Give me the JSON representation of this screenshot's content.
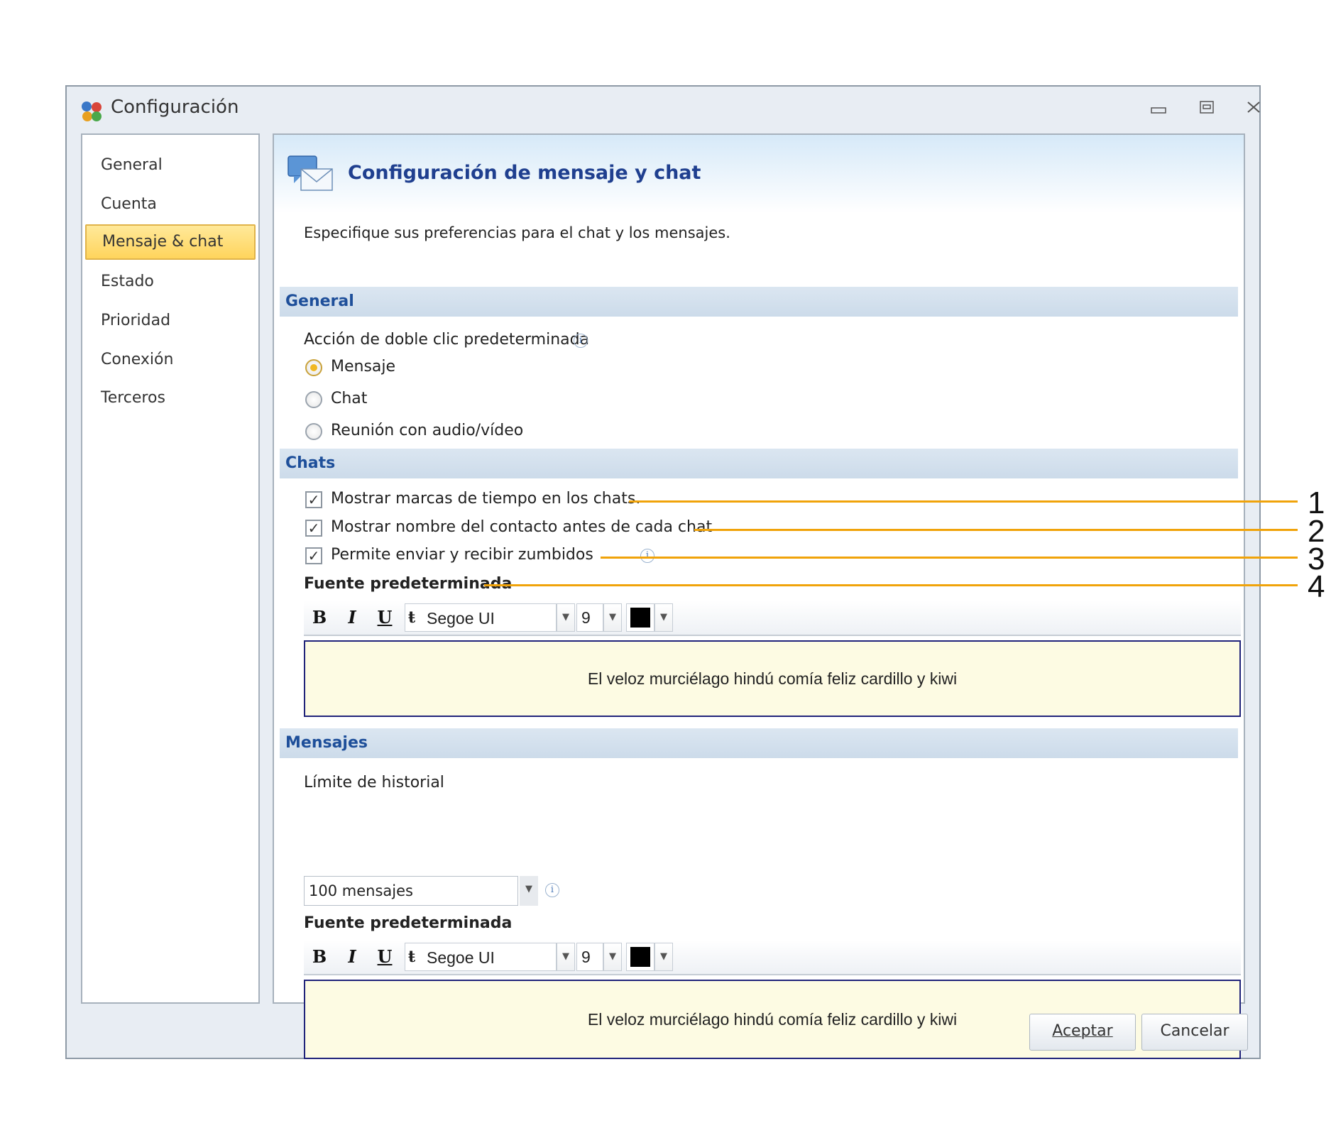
{
  "window": {
    "title": "Configuración",
    "controls": [
      "minimize",
      "restore",
      "close"
    ]
  },
  "sidebar": {
    "items": [
      {
        "label": "General",
        "selected": false
      },
      {
        "label": "Cuenta",
        "selected": false
      },
      {
        "label": "Mensaje & chat",
        "selected": true
      },
      {
        "label": "Estado",
        "selected": false
      },
      {
        "label": "Prioridad",
        "selected": false
      },
      {
        "label": "Conexión",
        "selected": false
      },
      {
        "label": "Terceros",
        "selected": false
      }
    ]
  },
  "header": {
    "icon": "message-chat-icon",
    "title": "Configuración de mensaje y chat",
    "description": "Especifique sus preferencias para el chat  y los mensajes."
  },
  "general": {
    "section_title": "General",
    "double_click_label": "Acción de doble clic predeterminada",
    "options": [
      {
        "label": "Mensaje",
        "selected": true
      },
      {
        "label": "Chat",
        "selected": false
      },
      {
        "label": "Reunión con audio/vídeo",
        "selected": false
      }
    ]
  },
  "chats": {
    "section_title": "Chats",
    "checkboxes": [
      {
        "label": "Mostrar marcas de tiempo en los chats.",
        "checked": true
      },
      {
        "label": "Mostrar nombre del contacto antes de cada chat",
        "checked": true
      },
      {
        "label": "Permite enviar y recibir zumbidos",
        "checked": true
      }
    ],
    "font_label": "Fuente predeterminada",
    "font": {
      "bold": "B",
      "italic": "I",
      "underline": "U",
      "family": "Segoe UI",
      "size": "9",
      "color": "#000000"
    },
    "preview_text": "El veloz murciélago hindú comía feliz cardillo y kiwi"
  },
  "messages": {
    "section_title": "Mensajes",
    "history_label": "Límite de historial",
    "history_value": "100 mensajes",
    "font_label": "Fuente predeterminada",
    "font": {
      "bold": "B",
      "italic": "I",
      "underline": "U",
      "family": "Segoe UI",
      "size": "9",
      "color": "#000000"
    },
    "preview_text": "El veloz murciélago hindú comía feliz cardillo y kiwi"
  },
  "buttons": {
    "accept": "Aceptar",
    "cancel": "Cancelar"
  },
  "callouts": [
    "1",
    "2",
    "3",
    "4"
  ],
  "colors": {
    "callout": "#f0a30a",
    "accent_title": "#1f3f8f",
    "selected_nav": "#ffd45c",
    "preview_bg": "#fdfbe3"
  }
}
